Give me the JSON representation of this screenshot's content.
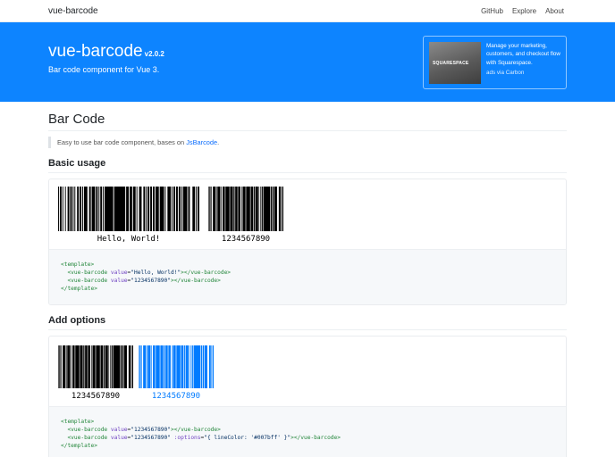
{
  "navbar": {
    "brand": "vue-barcode",
    "links": [
      "GitHub",
      "Explore",
      "About"
    ]
  },
  "hero": {
    "title": "vue-barcode",
    "version": "v2.0.2",
    "subtitle": "Bar code component for Vue 3."
  },
  "ad": {
    "logo_text": "SQUARESPACE",
    "text": "Manage your marketing, customers, and checkout flow with Squarespace.",
    "via": "ads via Carbon"
  },
  "page": {
    "title": "Bar Code",
    "intro_prefix": "Easy to use bar code component, bases on ",
    "intro_link": "JsBarcode",
    "intro_suffix": "."
  },
  "basic": {
    "heading": "Basic usage",
    "barcodes": [
      {
        "value": "Hello, World!",
        "color": "#000000"
      },
      {
        "value": "1234567890",
        "color": "#000000"
      }
    ],
    "code_lines": [
      [
        {
          "t": "tag",
          "v": "<template>"
        }
      ],
      [
        {
          "t": "sp",
          "v": "  "
        },
        {
          "t": "tag",
          "v": "<vue-barcode "
        },
        {
          "t": "attr",
          "v": "value"
        },
        {
          "t": "plain",
          "v": "="
        },
        {
          "t": "val",
          "v": "\"Hello, World!\""
        },
        {
          "t": "tag",
          "v": "></vue-barcode>"
        }
      ],
      [
        {
          "t": "sp",
          "v": "  "
        },
        {
          "t": "tag",
          "v": "<vue-barcode "
        },
        {
          "t": "attr",
          "v": "value"
        },
        {
          "t": "plain",
          "v": "="
        },
        {
          "t": "val",
          "v": "\"1234567890\""
        },
        {
          "t": "tag",
          "v": "></vue-barcode>"
        }
      ],
      [
        {
          "t": "tag",
          "v": "</template>"
        }
      ]
    ]
  },
  "options": {
    "heading": "Add options",
    "barcodes": [
      {
        "value": "1234567890",
        "color": "#000000"
      },
      {
        "value": "1234567890",
        "color": "#007bff"
      }
    ],
    "code_lines": [
      [
        {
          "t": "tag",
          "v": "<template>"
        }
      ],
      [
        {
          "t": "sp",
          "v": "  "
        },
        {
          "t": "tag",
          "v": "<vue-barcode "
        },
        {
          "t": "attr",
          "v": "value"
        },
        {
          "t": "plain",
          "v": "="
        },
        {
          "t": "val",
          "v": "\"1234567890\""
        },
        {
          "t": "tag",
          "v": "></vue-barcode>"
        }
      ],
      [
        {
          "t": "sp",
          "v": "  "
        },
        {
          "t": "tag",
          "v": "<vue-barcode "
        },
        {
          "t": "attr",
          "v": "value"
        },
        {
          "t": "plain",
          "v": "="
        },
        {
          "t": "val",
          "v": "\"1234567890\""
        },
        {
          "t": "plain",
          "v": " "
        },
        {
          "t": "attr",
          "v": ":options"
        },
        {
          "t": "plain",
          "v": "="
        },
        {
          "t": "val",
          "v": "\"{ lineColor: '#007bff' }\""
        },
        {
          "t": "tag",
          "v": "></vue-barcode>"
        }
      ],
      [
        {
          "t": "tag",
          "v": "</template>"
        }
      ]
    ]
  }
}
